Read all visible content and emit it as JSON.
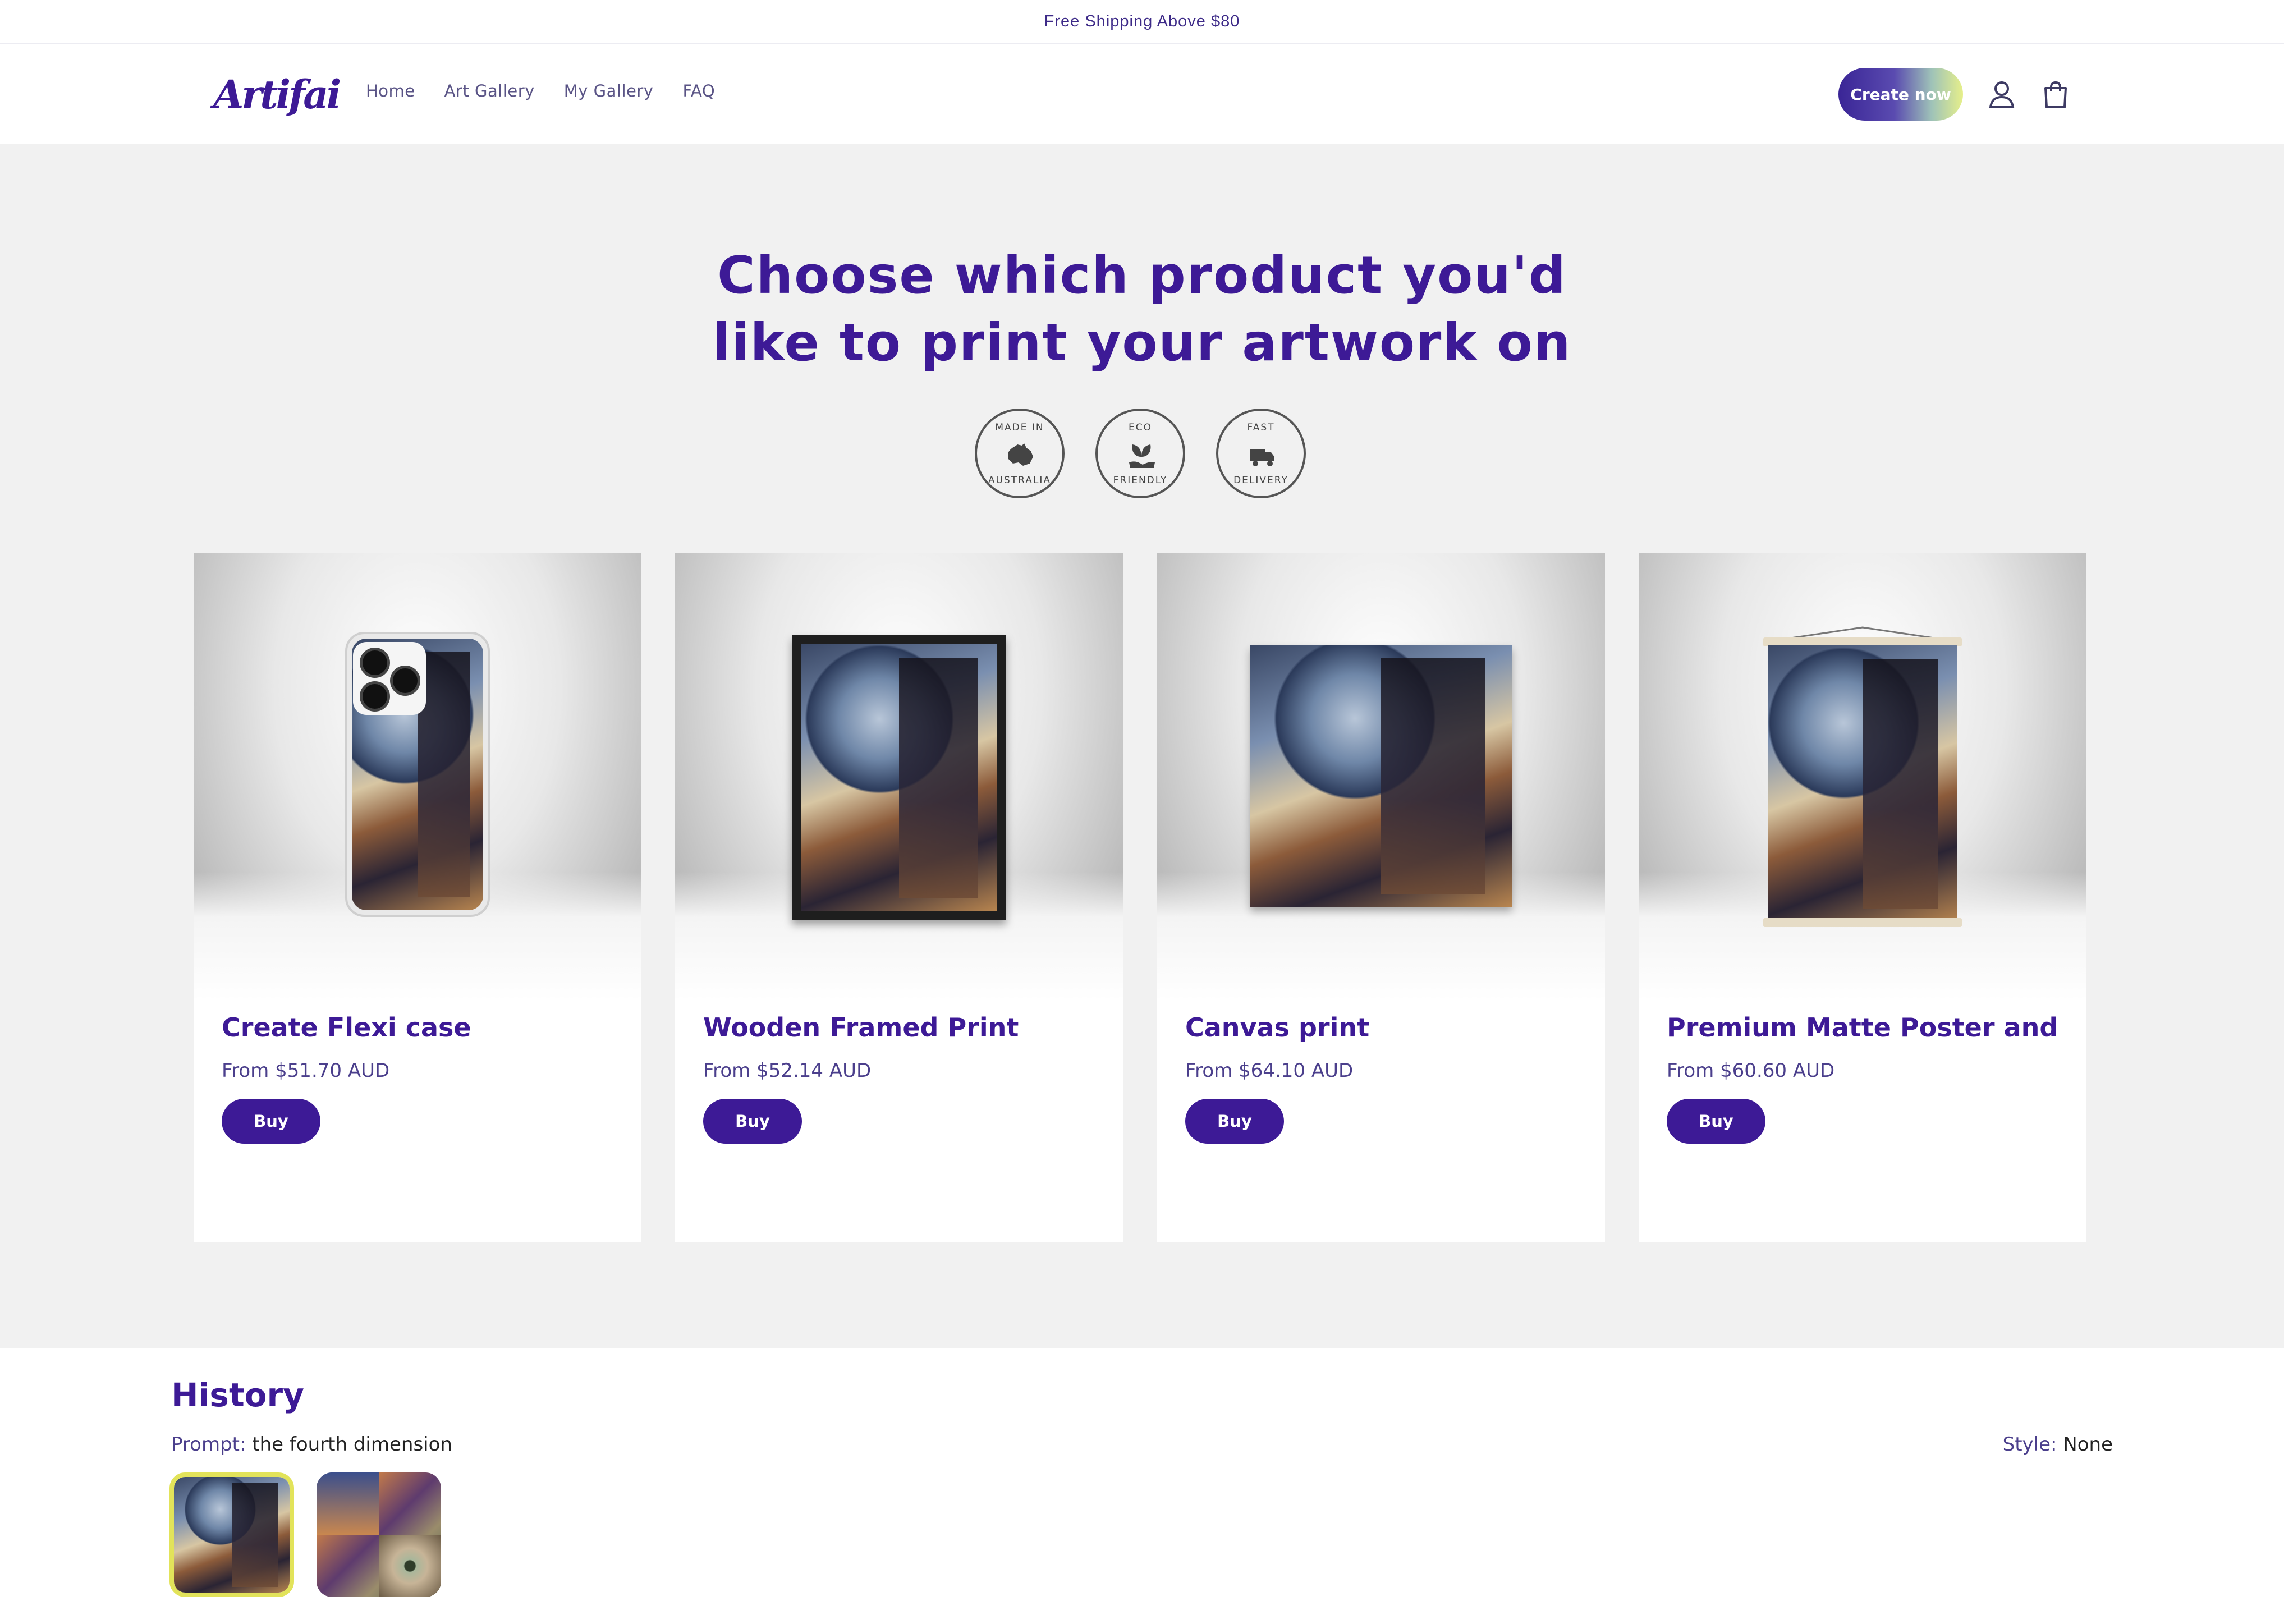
{
  "announcement": {
    "text": "Free Shipping Above $80"
  },
  "header": {
    "logo_text": "Artifai",
    "nav": [
      "Home",
      "Art Gallery",
      "My Gallery",
      "FAQ"
    ],
    "create_label": "Create now"
  },
  "hero": {
    "heading_line1": "Choose which product you'd",
    "heading_line2": "like to print your artwork on",
    "badges": [
      {
        "top": "MADE IN",
        "bottom": "AUSTRALIA",
        "icon": "australia-map-icon"
      },
      {
        "top": "ECO",
        "bottom": "FRIENDLY",
        "icon": "leaf-hand-icon"
      },
      {
        "top": "FAST",
        "bottom": "DELIVERY",
        "icon": "delivery-truck-icon"
      }
    ]
  },
  "products": [
    {
      "title": "Create Flexi case",
      "price": "From $51.70 AUD",
      "buy": "Buy"
    },
    {
      "title": "Wooden Framed Print",
      "price": "From $52.14 AUD",
      "buy": "Buy"
    },
    {
      "title": "Canvas print",
      "price": "From $64.10 AUD",
      "buy": "Buy"
    },
    {
      "title": "Premium Matte Poster and ...",
      "price": "From $60.60 AUD",
      "buy": "Buy"
    }
  ],
  "history": {
    "title": "History",
    "prompt_label": "Prompt:",
    "prompt_value": "the fourth dimension",
    "style_label": "Style:",
    "style_value": "None"
  },
  "colors": {
    "brand": "#3d1a96",
    "accent_yellow": "#e2e35a",
    "background_grey": "#f1f1f1"
  }
}
